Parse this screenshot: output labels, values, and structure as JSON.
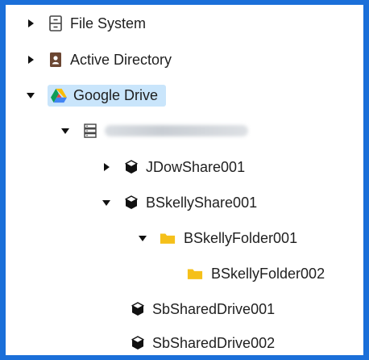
{
  "tree": {
    "items": [
      {
        "label": "File System",
        "icon": "file-cabinet-icon",
        "expanded": false
      },
      {
        "label": "Active Directory",
        "icon": "address-book-icon",
        "expanded": false
      },
      {
        "label": "Google Drive",
        "icon": "google-drive-icon",
        "expanded": true,
        "selected": true
      },
      {
        "label": "",
        "icon": "server-icon",
        "expanded": true,
        "redacted": true
      },
      {
        "label": "JDowShare001",
        "icon": "cube-icon",
        "expanded": false
      },
      {
        "label": "BSkellyShare001",
        "icon": "cube-icon",
        "expanded": true
      },
      {
        "label": "BSkellyFolder001",
        "icon": "folder-icon",
        "expanded": true
      },
      {
        "label": "BSkellyFolder002",
        "icon": "folder-icon"
      },
      {
        "label": "SbSharedDrive001",
        "icon": "cube-icon"
      },
      {
        "label": "SbSharedDrive002",
        "icon": "cube-icon"
      }
    ]
  },
  "colors": {
    "frame": "#1a6fd9",
    "selection": "#c9e5fb",
    "folder": "#f5c01a"
  }
}
